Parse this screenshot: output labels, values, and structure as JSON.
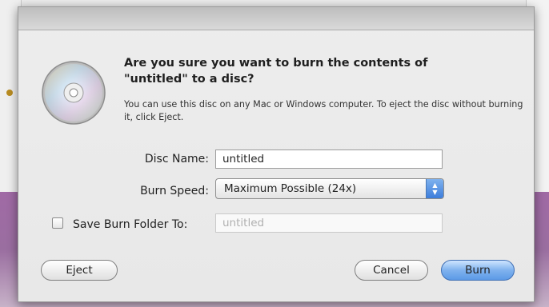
{
  "dialog": {
    "title": "Are you sure you want to burn the contents of \"untitled\" to a disc?",
    "message": "You can use this disc on any Mac or Windows computer. To eject the disc without burning it, click Eject.",
    "disc_name_label": "Disc Name:",
    "disc_name_value": "untitled",
    "burn_speed_label": "Burn Speed:",
    "burn_speed_value": "Maximum Possible (24x)",
    "save_folder_label": "Save Burn Folder To:",
    "save_folder_value": "untitled",
    "save_folder_checked": false,
    "buttons": {
      "eject": "Eject",
      "cancel": "Cancel",
      "burn": "Burn"
    },
    "icon": "disc-icon",
    "accent_color": "#5c9ae6"
  }
}
